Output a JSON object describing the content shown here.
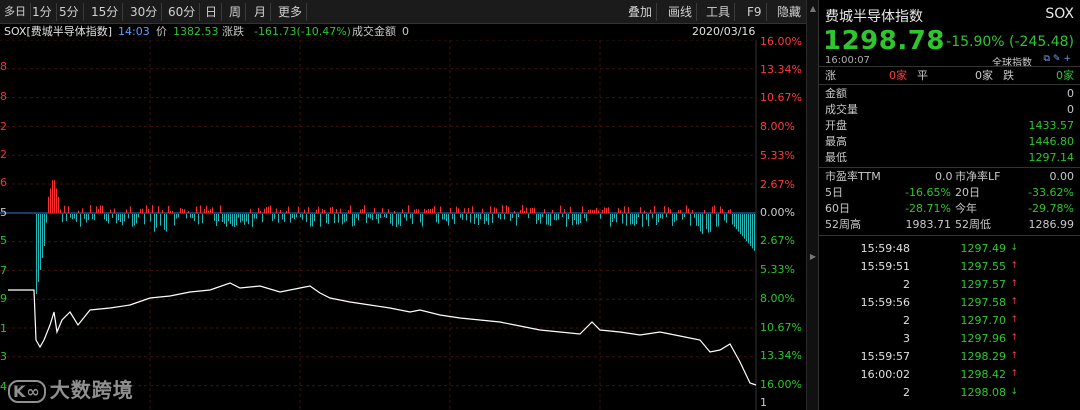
{
  "toolbar": {
    "periods": [
      "多日",
      "1分",
      "5分",
      "15分",
      "30分",
      "60分",
      "日",
      "周",
      "月",
      "更多"
    ],
    "right_buttons": [
      "叠加",
      "画线",
      "工具",
      "F9",
      "隐藏"
    ]
  },
  "header": {
    "symbol": "SOX[费城半导体指数]",
    "time": "14:03",
    "price_label": "价",
    "price": "1382.53",
    "change_label": "涨跌",
    "change": "-161.73(-10.47%)",
    "volume_label": "成交金额",
    "volume": "0",
    "date": "2020/03/16"
  },
  "chart": {
    "left_labels": [
      "8",
      "8",
      "2",
      "2",
      "6",
      "5",
      "5",
      "7",
      "9",
      "1",
      "3",
      "4"
    ],
    "right_labels": [
      "16.00%",
      "13.34%",
      "10.67%",
      "8.00%",
      "5.33%",
      "2.67%",
      "0.00%",
      "2.67%",
      "5.33%",
      "8.00%",
      "10.67%",
      "13.34%",
      "16.00%"
    ],
    "bottom_right_label": "1",
    "colors": {
      "up": "#ff2e2e",
      "down": "#22b8b8",
      "line": "#ffffff",
      "zero": "#3a6fd8",
      "grid": "#3b1010"
    }
  },
  "panel": {
    "name": "费城半导体指数",
    "code": "SOX",
    "price": "1298.78",
    "change": "-15.90% (-245.48)",
    "time": "16:00:07",
    "global_label": "全球指数",
    "stats_rise_label": "涨",
    "stats_rise": "0家",
    "stats_flat_label": "平",
    "stats_flat": "0家",
    "stats_fall_label": "跌",
    "stats_fall": "0家",
    "amount_label": "金额",
    "amount": "0",
    "vol_label": "成交量",
    "vol": "0",
    "open_label": "开盘",
    "open": "1433.57",
    "high_label": "最高",
    "high": "1446.80",
    "low_label": "最低",
    "low": "1297.14",
    "pe_label": "市盈率TTM",
    "pe": "0.0",
    "pb_label": "市净率LF",
    "pb": "0.00",
    "d5_label": "5日",
    "d5": "-16.65%",
    "d20_label": "20日",
    "d20": "-33.62%",
    "d60_label": "60日",
    "d60": "-28.71%",
    "ytd_label": "今年",
    "ytd": "-29.78%",
    "w52h_label": "52周高",
    "w52h": "1983.71",
    "w52l_label": "52周低",
    "w52l": "1286.99",
    "ticks": [
      {
        "time": "15:59:48",
        "price": "1297.49",
        "dir": "down"
      },
      {
        "time": "15:59:51",
        "price": "1297.55",
        "dir": "up"
      },
      {
        "time": "2",
        "price": "1297.57",
        "dir": "up"
      },
      {
        "time": "15:59:56",
        "price": "1297.58",
        "dir": "up"
      },
      {
        "time": "2",
        "price": "1297.70",
        "dir": "up"
      },
      {
        "time": "3",
        "price": "1297.96",
        "dir": "up"
      },
      {
        "time": "15:59:57",
        "price": "1298.29",
        "dir": "up"
      },
      {
        "time": "16:00:02",
        "price": "1298.42",
        "dir": "up"
      },
      {
        "time": "2",
        "price": "1298.08",
        "dir": "down"
      }
    ]
  },
  "watermark": "大数跨境"
}
